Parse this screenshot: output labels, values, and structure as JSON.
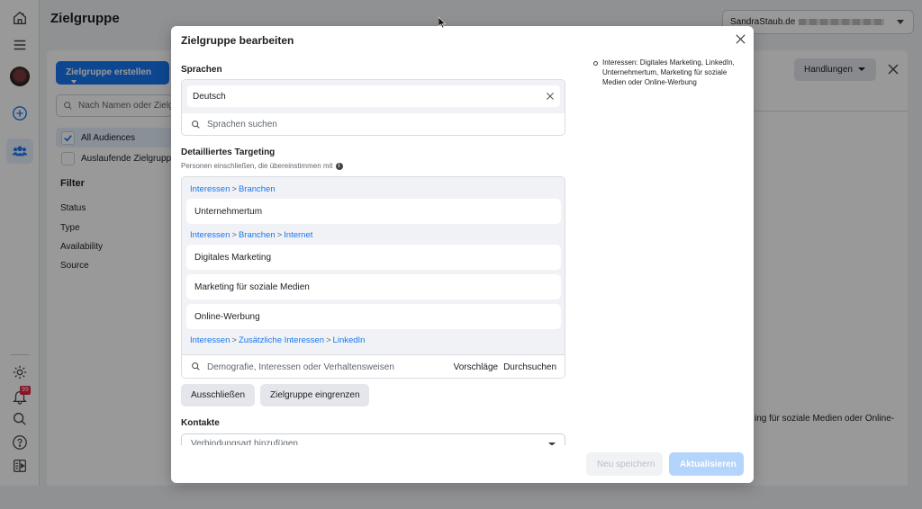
{
  "app": {
    "page_title": "Zielgruppe",
    "account_name": "SandraStaub.de",
    "notification_count": "99",
    "rail_icons": [
      "home-icon",
      "menu-icon",
      "avatar",
      "create-icon",
      "audiences-icon",
      "settings-icon",
      "notifications-icon",
      "search-icon",
      "help-icon",
      "panel-toggle-icon"
    ]
  },
  "left_panel": {
    "create_button": "Zielgruppe erstellen",
    "search_placeholder": "Nach Namen oder Zielgruppen-ID suchen",
    "audience_filters": [
      {
        "label": "All Audiences",
        "checked": true
      },
      {
        "label": "Auslaufende Zielgruppen",
        "checked": false
      }
    ],
    "filter_heading": "Filter",
    "filter_items": [
      "Status",
      "Type",
      "Availability",
      "Source"
    ]
  },
  "detail_panel": {
    "actions_button": "Handlungen",
    "snippet_text": "ing für soziale Medien oder Online-"
  },
  "modal": {
    "title": "Zielgruppe bearbeiten",
    "summary": "Interessen: Digitales Marketing, LinkedIn, Unternehmertum, Marketing für soziale Medien oder Online-Werbung",
    "languages": {
      "label": "Sprachen",
      "selected": "Deutsch",
      "search_placeholder": "Sprachen suchen"
    },
    "detailed_targeting": {
      "label": "Detailliertes Targeting",
      "sublabel": "Personen einschließen, die übereinstimmen mit",
      "groups": [
        {
          "path": [
            "Interessen",
            "Branchen"
          ],
          "items": [
            "Unternehmertum"
          ]
        },
        {
          "path": [
            "Interessen",
            "Branchen",
            "Internet"
          ],
          "items": [
            "Digitales Marketing",
            "Marketing für soziale Medien",
            "Online-Werbung"
          ]
        },
        {
          "path": [
            "Interessen",
            "Zusätzliche Interessen",
            "LinkedIn"
          ],
          "items": []
        }
      ],
      "search_placeholder": "Demografie, Interessen oder Verhaltensweisen",
      "suggestions_label": "Vorschläge",
      "browse_label": "Durchsuchen"
    },
    "exclude_button": "Ausschließen",
    "narrow_button": "Zielgruppe eingrenzen",
    "contacts": {
      "label": "Kontakte",
      "placeholder": "Verbindungsart hinzufügen"
    },
    "save_new_button": "Neu speichern",
    "update_button": "Aktualisieren"
  },
  "colors": {
    "accent": "#1877f2",
    "link": "#1877f2",
    "update_disabled": "#b3d4fb",
    "badge": "#e41e3f"
  }
}
